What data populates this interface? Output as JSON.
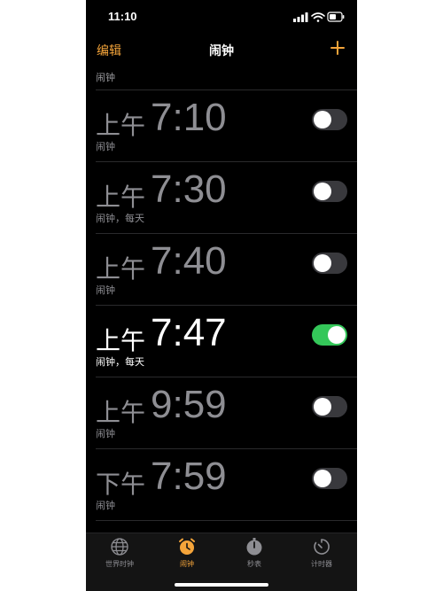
{
  "status_bar": {
    "time": "11:10",
    "battery_icon": "battery-icon",
    "wifi_icon": "wifi-icon",
    "signal_icon": "signal-icon"
  },
  "nav": {
    "edit_label": "编辑",
    "title": "闹钟",
    "add_icon": "plus-icon"
  },
  "top_label": "闹钟",
  "alarms": [
    {
      "ampm": "上午",
      "time": "7:10",
      "label": "闹钟",
      "enabled": false
    },
    {
      "ampm": "上午",
      "time": "7:30",
      "label": "闹钟，每天",
      "enabled": false
    },
    {
      "ampm": "上午",
      "time": "7:40",
      "label": "闹钟",
      "enabled": false
    },
    {
      "ampm": "上午",
      "time": "7:47",
      "label": "闹钟，每天",
      "enabled": true
    },
    {
      "ampm": "上午",
      "time": "9:59",
      "label": "闹钟",
      "enabled": false
    },
    {
      "ampm": "下午",
      "time": "7:59",
      "label": "闹钟",
      "enabled": false
    }
  ],
  "tabs": [
    {
      "label": "世界时钟",
      "icon": "globe-icon",
      "active": false
    },
    {
      "label": "闹钟",
      "icon": "alarm-clock-icon",
      "active": true
    },
    {
      "label": "秒表",
      "icon": "stopwatch-icon",
      "active": false
    },
    {
      "label": "计时器",
      "icon": "timer-icon",
      "active": false
    }
  ],
  "colors": {
    "accent": "#f4a43a",
    "toggle_on": "#34c759",
    "toggle_off": "#39393d",
    "inactive_text": "#8e8e93"
  }
}
